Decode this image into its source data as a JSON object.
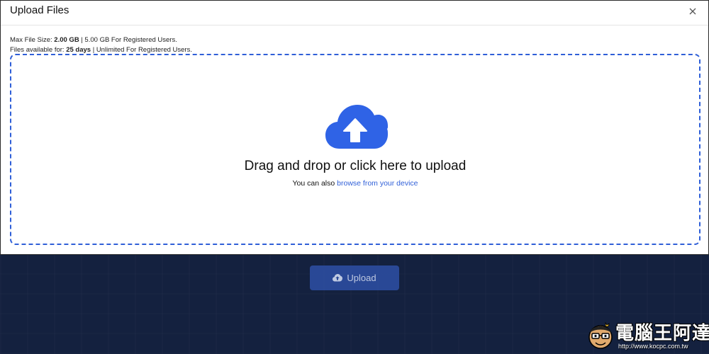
{
  "modal": {
    "title": "Upload Files",
    "close_icon": "close-icon"
  },
  "info": {
    "line1_prefix": "Max File Size: ",
    "line1_value": "2.00 GB",
    "line1_suffix": " | 5.00 GB For Registered Users.",
    "line2_prefix": "Files available for: ",
    "line2_value": "25 days",
    "line2_suffix": " | Unlimited For Registered Users."
  },
  "dropzone": {
    "icon": "cloud-upload-icon",
    "title": "Drag and drop or click here to upload",
    "sub_prefix": "You can also ",
    "browse_link": "browse from your device"
  },
  "upload_button": {
    "label": "Upload",
    "icon": "cloud-upload-icon"
  },
  "watermark": {
    "text": "電腦王阿達",
    "url": "http://www.kocpc.com.tw"
  },
  "colors": {
    "accent": "#2f5fd8",
    "background": "#13203e",
    "button": "#2b4b9b"
  }
}
